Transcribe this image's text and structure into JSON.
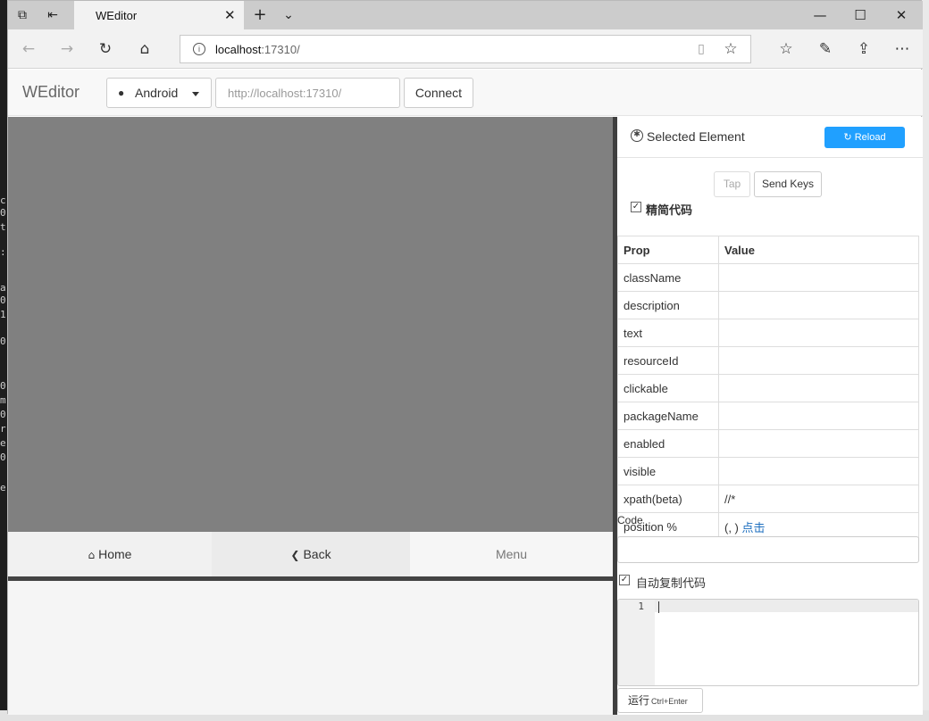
{
  "browser": {
    "tab_title": "WEditor",
    "url_host": "localhost",
    "url_path": ":17310/",
    "icons": [
      "tab-manager-icon",
      "set-aside-icon",
      "new-tab-icon",
      "tab-list-chevron-icon",
      "back-icon",
      "forward-icon",
      "refresh-icon",
      "home-icon",
      "info-icon",
      "reading-view-icon",
      "favorite-star-icon",
      "favorites-hub-icon",
      "notes-pen-icon",
      "share-icon",
      "more-icon",
      "minimize-icon",
      "maximize-icon",
      "close-icon"
    ]
  },
  "toolbar": {
    "brand": "WEditor",
    "platform": "Android",
    "device_url_placeholder": "http://localhost:17310/",
    "connect_label": "Connect"
  },
  "device": {
    "screen_color": "#808080",
    "keys": {
      "home": "Home",
      "back": "Back",
      "menu": "Menu"
    }
  },
  "panel": {
    "title": "Selected Element",
    "reload_label": "Reload",
    "tap_label": "Tap",
    "send_keys_label": "Send Keys",
    "simplify_label": "精简代码",
    "simplify_checked": true,
    "table": {
      "headers": {
        "prop": "Prop",
        "value": "Value"
      },
      "rows": [
        {
          "prop": "className",
          "value": ""
        },
        {
          "prop": "description",
          "value": ""
        },
        {
          "prop": "text",
          "value": ""
        },
        {
          "prop": "resourceId",
          "value": ""
        },
        {
          "prop": "clickable",
          "value": ""
        },
        {
          "prop": "packageName",
          "value": ""
        },
        {
          "prop": "enabled",
          "value": ""
        },
        {
          "prop": "visible",
          "value": ""
        },
        {
          "prop": "xpath(beta)",
          "value": "//*"
        },
        {
          "prop": "position %",
          "value": "(, )",
          "link": "点击"
        }
      ]
    },
    "code_label": "Code",
    "auto_copy_label": "自动复制代码",
    "auto_copy_checked": true,
    "editor_line": "1",
    "run_label": "运行",
    "run_shortcut": "Ctrl+Enter"
  },
  "colors": {
    "accent": "#20a0ff",
    "screen": "#808080",
    "link": "#1e6fbf"
  }
}
